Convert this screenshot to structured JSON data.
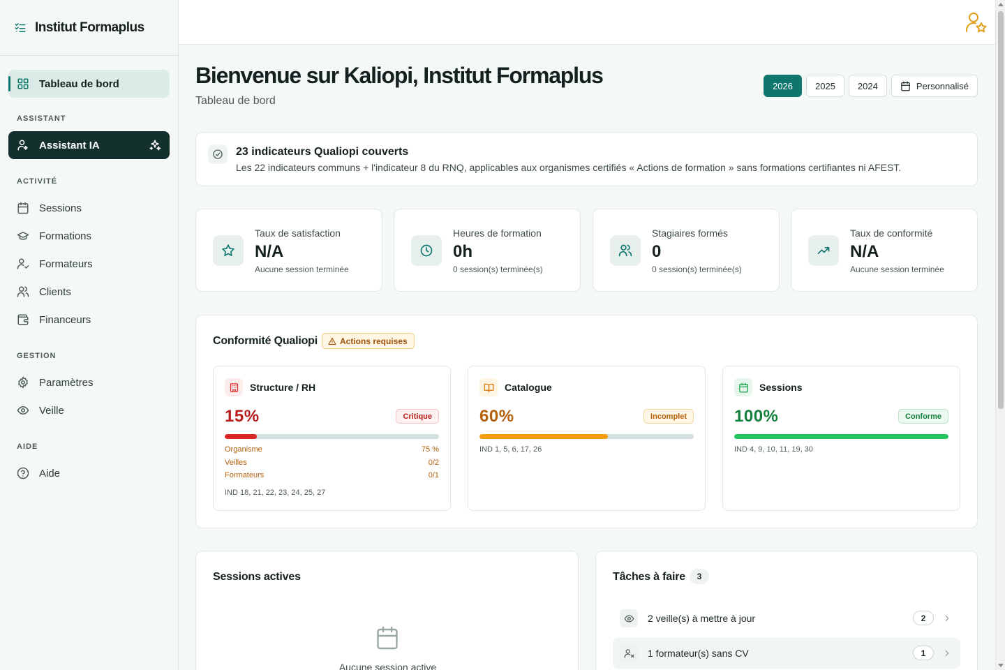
{
  "brand": {
    "name": "Institut Formaplus"
  },
  "sidebar": {
    "dashboard": {
      "label": "Tableau de bord"
    },
    "sections": {
      "assistant": "ASSISTANT",
      "activity": "ACTIVITÉ",
      "management": "GESTION",
      "help": "AIDE"
    },
    "assistant_item": {
      "label": "Assistant IA"
    },
    "activity_items": [
      {
        "label": "Sessions",
        "icon": "calendar-icon"
      },
      {
        "label": "Formations",
        "icon": "graduation-cap-icon"
      },
      {
        "label": "Formateurs",
        "icon": "user-check-icon"
      },
      {
        "label": "Clients",
        "icon": "users-icon"
      },
      {
        "label": "Financeurs",
        "icon": "wallet-icon"
      }
    ],
    "management_items": [
      {
        "label": "Paramètres",
        "icon": "gear-icon"
      },
      {
        "label": "Veille",
        "icon": "eye-icon"
      }
    ],
    "help_items": [
      {
        "label": "Aide",
        "icon": "help-circle-icon"
      }
    ]
  },
  "header": {
    "title": "Bienvenue sur Kaliopi, Institut Formaplus",
    "subtitle": "Tableau de bord",
    "years": [
      "2026",
      "2025",
      "2024"
    ],
    "active_year": "2026",
    "custom_label": "Personnalisé"
  },
  "info": {
    "title": "23 indicateurs Qualiopi couverts",
    "description": "Les 22 indicateurs communs + l'indicateur 8 du RNQ, applicables aux organismes certifiés « Actions de formation » sans formations certifiantes ni AFEST."
  },
  "stats": [
    {
      "label": "Taux de satisfaction",
      "value": "N/A",
      "sub": "Aucune session terminée",
      "icon": "star-icon"
    },
    {
      "label": "Heures de formation",
      "value": "0h",
      "sub": "0 session(s) terminée(s)",
      "icon": "clock-icon"
    },
    {
      "label": "Stagiaires formés",
      "value": "0",
      "sub": "0 session(s) terminée(s)",
      "icon": "users-icon"
    },
    {
      "label": "Taux de conformité",
      "value": "N/A",
      "sub": "Aucune session terminée",
      "icon": "trending-up-icon"
    }
  ],
  "conformity": {
    "title": "Conformité Qualiopi",
    "badge": "Actions requises",
    "cards": [
      {
        "title": "Structure / RH",
        "percent": "15%",
        "progress": 0.15,
        "status": "Critique",
        "color": "#dc2626",
        "rows": [
          {
            "label": "Organisme",
            "value": "75 %"
          },
          {
            "label": "Veilles",
            "value": "0/2"
          },
          {
            "label": "Formateurs",
            "value": "0/1"
          }
        ],
        "indicators": "IND 18, 21, 22, 23, 24, 25, 27"
      },
      {
        "title": "Catalogue",
        "percent": "60%",
        "progress": 0.6,
        "status": "Incomplet",
        "color": "#f59e0b",
        "indicators": "IND 1, 5, 6, 17, 26"
      },
      {
        "title": "Sessions",
        "percent": "100%",
        "progress": 1.0,
        "status": "Conforme",
        "color": "#22c55e",
        "indicators": "IND 4, 9, 10, 11, 19, 30"
      }
    ]
  },
  "sessions": {
    "title": "Sessions actives",
    "empty": "Aucune session active"
  },
  "tasks": {
    "title": "Tâches à faire",
    "count": "3",
    "items": [
      {
        "label": "2 veille(s) à mettre à jour",
        "count": "2",
        "icon": "eye-icon"
      },
      {
        "label": "1 formateur(s) sans CV",
        "count": "1",
        "icon": "user-x-icon"
      }
    ]
  },
  "colors": {
    "accent": "#0f766e",
    "sidebar_ai": "#13302d",
    "warning": "#f59e0b",
    "danger": "#dc2626",
    "success": "#22c55e"
  }
}
